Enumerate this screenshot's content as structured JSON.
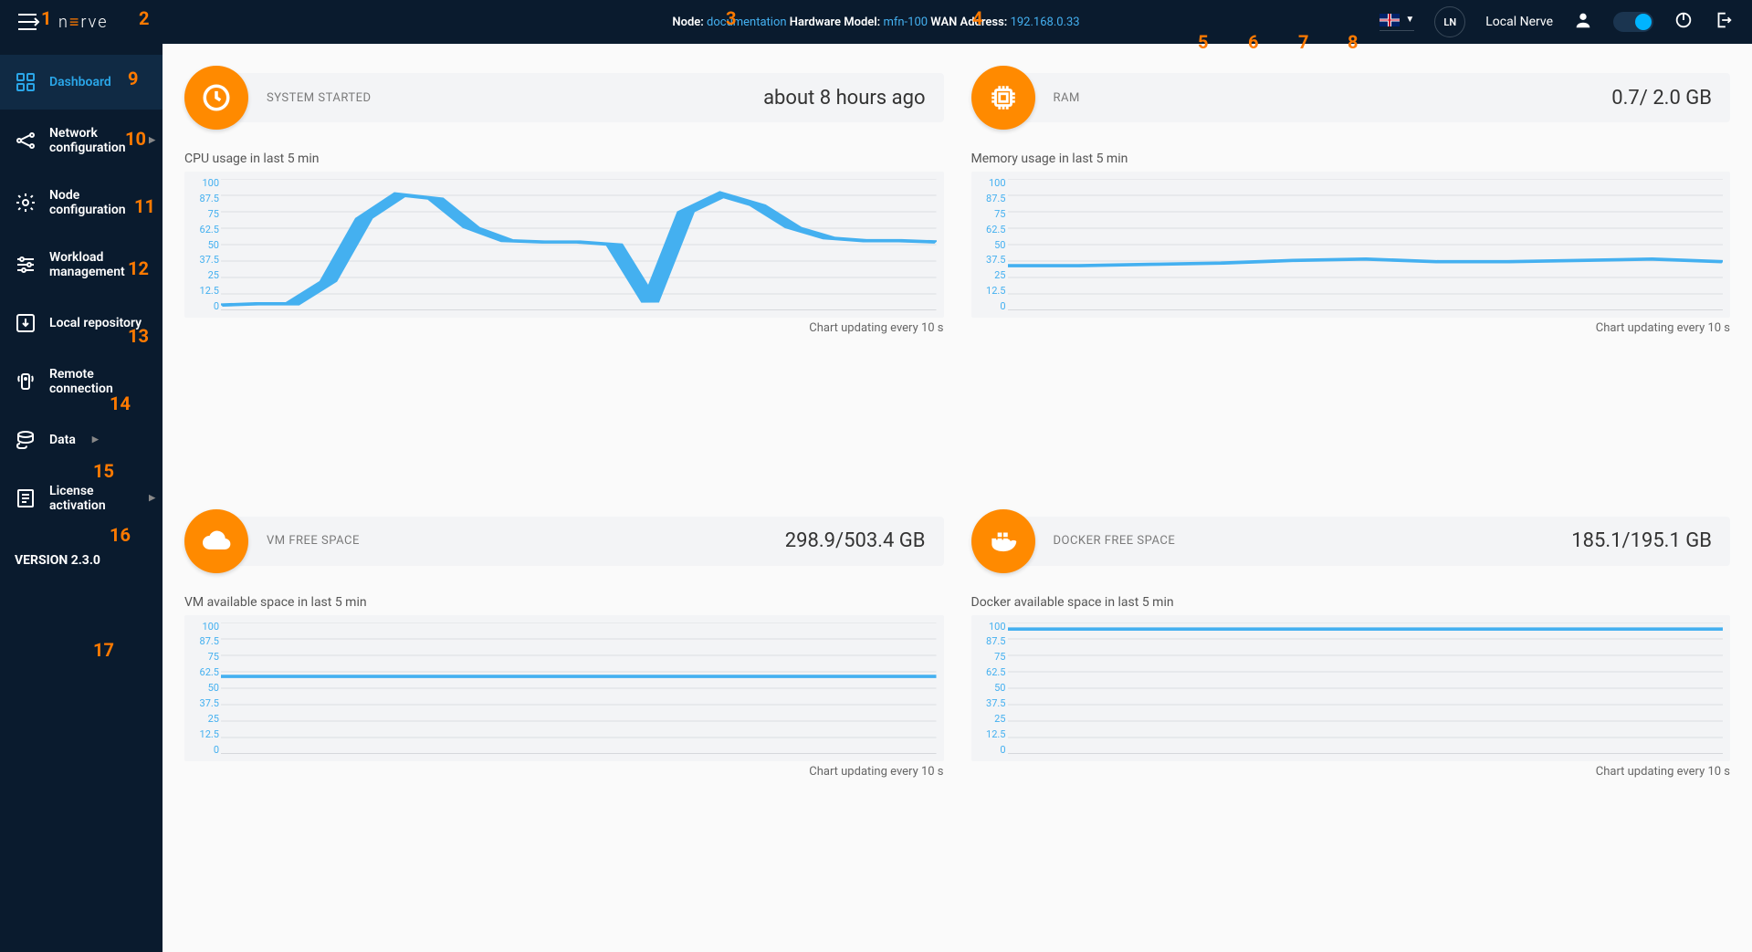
{
  "header": {
    "node_label": "Node:",
    "node_value": "documentation",
    "model_label": "Hardware Model:",
    "model_value": "mfn-100",
    "wan_label": "WAN Address:",
    "wan_value": "192.168.0.33",
    "badge": "LN",
    "user_label": "Local Nerve"
  },
  "sidebar": {
    "items": [
      {
        "label": "Dashboard"
      },
      {
        "label": "Network configuration"
      },
      {
        "label": "Node configuration"
      },
      {
        "label": "Workload management"
      },
      {
        "label": "Local repository"
      },
      {
        "label": "Remote connection"
      },
      {
        "label": "Data"
      },
      {
        "label": "License activation"
      }
    ],
    "version": "VERSION 2.3.0"
  },
  "cards": {
    "system": {
      "type": "SYSTEM STARTED",
      "value": "about 8 hours ago",
      "chart_title": "CPU usage in last 5 min",
      "chart_foot": "Chart updating every 10 s"
    },
    "ram": {
      "type": "RAM",
      "value": "0.7/ 2.0 GB",
      "chart_title": "Memory usage in last 5 min",
      "chart_foot": "Chart updating every 10 s"
    },
    "vm": {
      "type": "VM FREE SPACE",
      "value": "298.9/503.4 GB",
      "chart_title": "VM available space in last 5 min",
      "chart_foot": "Chart updating every 10 s"
    },
    "docker": {
      "type": "DOCKER FREE SPACE",
      "value": "185.1/195.1 GB",
      "chart_title": "Docker available space in last 5 min",
      "chart_foot": "Chart updating every 10 s"
    }
  },
  "y_ticks": [
    "100",
    "87.5",
    "75",
    "62.5",
    "50",
    "37.5",
    "25",
    "12.5",
    "0"
  ],
  "chart_data": [
    {
      "type": "line",
      "title": "CPU usage in last 5 min",
      "ylabel": "",
      "xlabel": "",
      "ylim": [
        0,
        100
      ],
      "x": [
        0,
        5,
        10,
        15,
        20,
        25,
        30,
        35,
        40,
        45,
        50,
        55,
        60,
        65,
        70,
        75,
        80,
        85,
        90,
        95,
        100
      ],
      "values": [
        4,
        5,
        5,
        22,
        70,
        88,
        85,
        63,
        53,
        52,
        52,
        50,
        6,
        75,
        88,
        80,
        63,
        55,
        53,
        53,
        52
      ]
    },
    {
      "type": "line",
      "title": "Memory usage in last 5 min",
      "ylabel": "",
      "xlabel": "",
      "ylim": [
        0,
        100
      ],
      "x": [
        0,
        10,
        20,
        30,
        40,
        50,
        60,
        70,
        80,
        90,
        100
      ],
      "values": [
        34,
        34,
        35,
        36,
        38,
        39,
        37,
        37,
        38,
        39,
        37
      ]
    },
    {
      "type": "line",
      "title": "VM available space in last 5 min",
      "ylabel": "",
      "xlabel": "",
      "ylim": [
        0,
        100
      ],
      "x": [
        0,
        100
      ],
      "values": [
        59,
        59
      ]
    },
    {
      "type": "line",
      "title": "Docker available space in last 5 min",
      "ylabel": "",
      "xlabel": "",
      "ylim": [
        0,
        100
      ],
      "x": [
        0,
        100
      ],
      "values": [
        95,
        95
      ]
    }
  ],
  "markers": [
    "1",
    "2",
    "3",
    "4",
    "5",
    "6",
    "7",
    "8",
    "9",
    "10",
    "11",
    "12",
    "13",
    "14",
    "15",
    "16",
    "17"
  ]
}
